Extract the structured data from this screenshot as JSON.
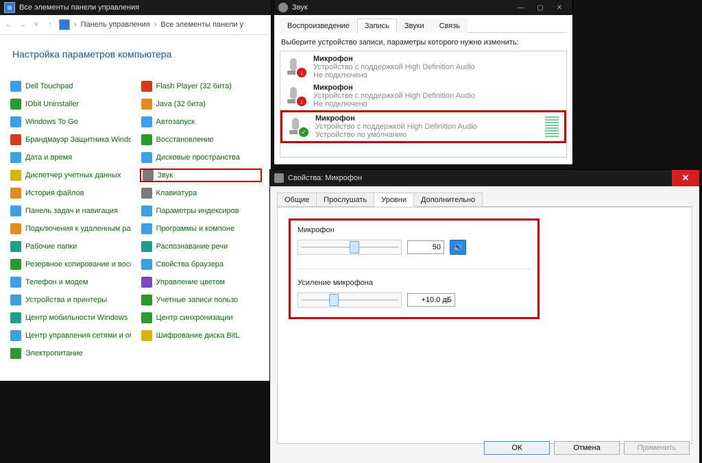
{
  "cp": {
    "title": "Все элементы панели управления",
    "breadcrumb1": "Панель управления",
    "breadcrumb2": "Все элементы панели у",
    "heading": "Настройка параметров компьютера",
    "col1": [
      {
        "label": "Dell Touchpad",
        "ico": ""
      },
      {
        "label": "IObit Uninstaller",
        "ico": "green"
      },
      {
        "label": "Windows To Go",
        "ico": ""
      },
      {
        "label": "Брандмауэр Защитника Windows",
        "ico": "red"
      },
      {
        "label": "Дата и время",
        "ico": ""
      },
      {
        "label": "Диспетчер учетных данных",
        "ico": "yellow"
      },
      {
        "label": "История файлов",
        "ico": "orange"
      },
      {
        "label": "Панель задач и навигация",
        "ico": ""
      },
      {
        "label": "Подключения к удаленным рабоч…",
        "ico": "orange"
      },
      {
        "label": "Рабочие папки",
        "ico": "teal"
      },
      {
        "label": "Резервное копирование и восстан…",
        "ico": "green"
      },
      {
        "label": "Телефон и модем",
        "ico": ""
      },
      {
        "label": "Устройства и принтеры",
        "ico": ""
      },
      {
        "label": "Центр мобильности Windows",
        "ico": "teal"
      },
      {
        "label": "Центр управления сетями и общи…",
        "ico": ""
      },
      {
        "label": "Электропитание",
        "ico": "green"
      }
    ],
    "col2": [
      {
        "label": "Flash Player (32 бита)",
        "ico": "red"
      },
      {
        "label": "Java (32 бита)",
        "ico": "orange"
      },
      {
        "label": "Автозапуск",
        "ico": ""
      },
      {
        "label": "Восстановление",
        "ico": "green"
      },
      {
        "label": "Дисковые пространства",
        "ico": ""
      },
      {
        "label": "Звук",
        "ico": "grey",
        "highlight": true
      },
      {
        "label": "Клавиатура",
        "ico": "grey"
      },
      {
        "label": "Параметры индексиров",
        "ico": ""
      },
      {
        "label": "Программы и компоне",
        "ico": ""
      },
      {
        "label": "Распознавание речи",
        "ico": "teal"
      },
      {
        "label": "Свойства браузера",
        "ico": ""
      },
      {
        "label": "Управление цветом",
        "ico": "purple"
      },
      {
        "label": "Учетные записи пользо",
        "ico": "green"
      },
      {
        "label": "Центр синхронизации",
        "ico": "green"
      },
      {
        "label": "Шифрование диска BitL",
        "ico": "yellow"
      }
    ]
  },
  "snd": {
    "title": "Звук",
    "tabs": {
      "t1": "Воспроизведение",
      "t2": "Запись",
      "t3": "Звуки",
      "t4": "Связь"
    },
    "instr": "Выберите устройство записи, параметры которого нужно изменить:",
    "devs": [
      {
        "name": "Микрофон",
        "sub1": "Устройство с поддержкой High Definition Audio",
        "sub2": "Не подключено",
        "badge": "down"
      },
      {
        "name": "Микрофон",
        "sub1": "Устройство с поддержкой High Definition Audio",
        "sub2": "Не подключено",
        "badge": "down"
      },
      {
        "name": "Микрофон",
        "sub1": "Устройство с поддержкой High Definition Audio",
        "sub2": "Устройство по умолчанию",
        "badge": "ok",
        "highlight": true,
        "level": true
      }
    ]
  },
  "prop": {
    "title": "Свойства: Микрофон",
    "tabs": {
      "t1": "Общие",
      "t2": "Прослушать",
      "t3": "Уровни",
      "t4": "Дополнительно"
    },
    "mic_label": "Микрофон",
    "mic_value": "50",
    "gain_label": "Усиление микрофона",
    "gain_value": "+10.0 дБ",
    "btn_ok": "ОК",
    "btn_cancel": "Отмена",
    "btn_apply": "Применить"
  }
}
